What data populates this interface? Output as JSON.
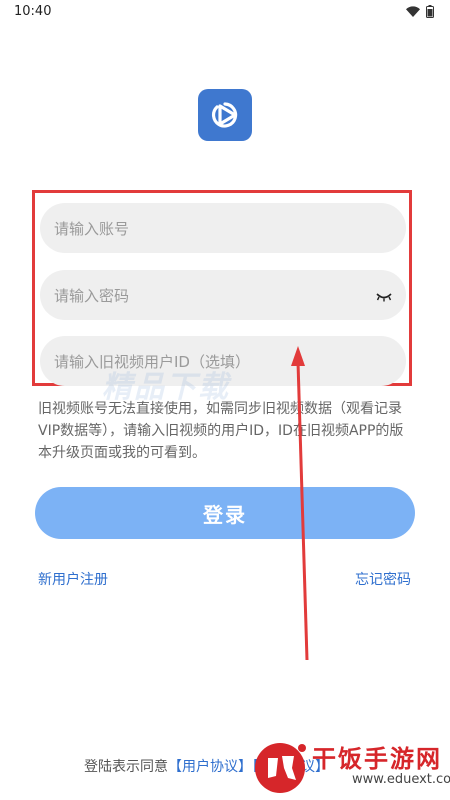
{
  "status_bar": {
    "time": "10:40"
  },
  "login_form": {
    "account_placeholder": "请输入账号",
    "password_placeholder": "请输入密码",
    "old_id_placeholder": "请输入旧视频用户ID（选填）",
    "hint": "旧视频账号无法直接使用，如需同步旧视频数据（观看记录 VIP数据等），请输入旧视频的用户ID，ID在旧视频APP的版本升级页面或我的可看到。",
    "login_label": "登录",
    "register_label": "新用户注册",
    "forgot_label": "忘记密码"
  },
  "agreement": {
    "prefix": "登陆表示同意",
    "user_agreement": "【用户协议】",
    "privacy_agreement": "【隐私协议】"
  },
  "watermarks": {
    "middle": "精品下载",
    "site_name": "干饭手游网",
    "site_url": "www.eduext.com"
  },
  "colors": {
    "brand": "#3f78cf",
    "button": "#7cb2f5",
    "link": "#2f6fce",
    "annotation": "#e23b3b"
  }
}
